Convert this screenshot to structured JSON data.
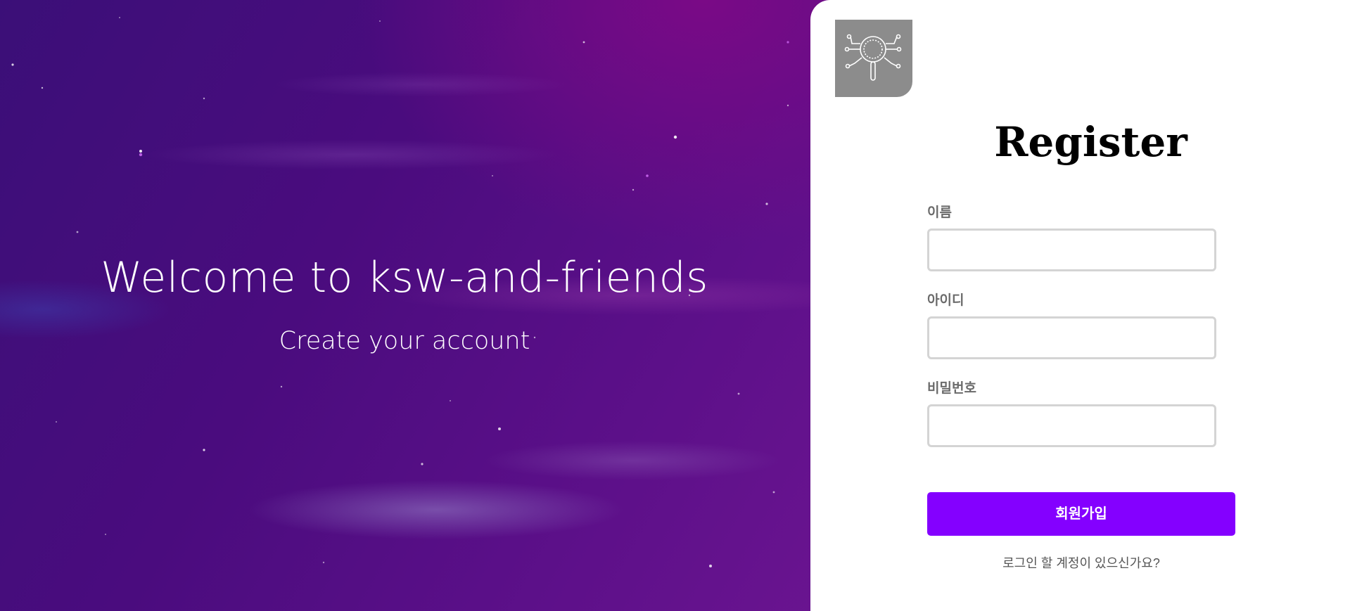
{
  "hero": {
    "welcome_text": "Welcome to ksw-and-friends",
    "subtitle": "Create your account"
  },
  "logo": {
    "icon": "magnifier-circuit-icon"
  },
  "form": {
    "title": "Register",
    "fields": [
      {
        "label": "이름",
        "value": ""
      },
      {
        "label": "아이디",
        "value": ""
      },
      {
        "label": "비밀번호",
        "value": ""
      }
    ],
    "submit_label": "회원가입",
    "login_link": "로그인 할 계정이 있으신가요?"
  },
  "colors": {
    "accent": "#8400ff",
    "background_purple": "#4a0c7e",
    "logo_bg": "#8c8c8c"
  }
}
